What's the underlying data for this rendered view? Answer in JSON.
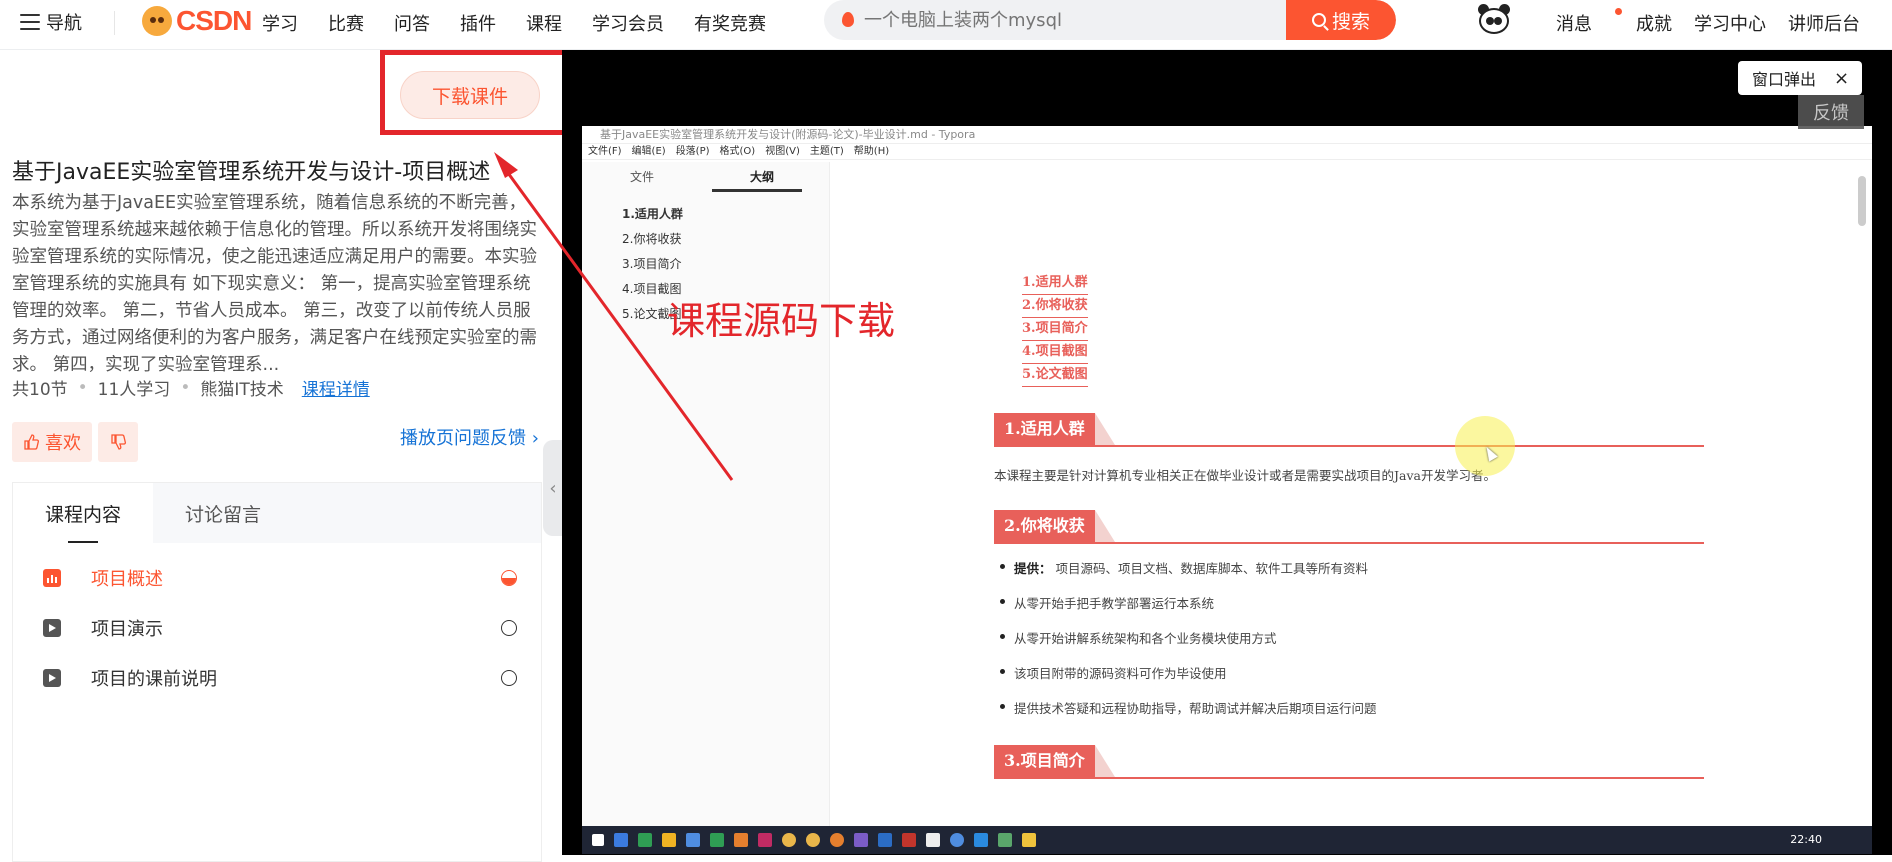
{
  "navbar": {
    "menu_label": "导航",
    "logo_text": "CSDN",
    "links": [
      "学习",
      "比赛",
      "问答",
      "插件",
      "课程",
      "学习会员",
      "有奖竞赛"
    ],
    "search_placeholder": "一个电脑上装两个mysql",
    "search_button": "搜索",
    "user_links": [
      "消息",
      "成就",
      "学习中心",
      "讲师后台"
    ]
  },
  "course": {
    "download_button": "下载课件",
    "title": "基于JavaEE实验室管理系统开发与设计-项目概述",
    "description": "本系统为基于JavaEE实验室管理系统，随着信息系统的不断完善，实验室管理系统越来越依赖于信息化的管理。所以系统开发将围绕实验室管理系统的实际情况，使之能迅速适应满足用户的需要。本实验室管理系统的实施具有 如下现实意义： 第一，提高实验室管理系统管理的效率。 第二，节省人员成本。 第三，改变了以前传统人员服务方式，通过网络便利的为客户服务，满足客户在线预定实验室的需求。 第四，实现了实验室管理系...",
    "lessons_count": "共10节",
    "learners": "11人学习",
    "author": "熊猫IT技术",
    "detail_link": "课程详情",
    "like_label": "喜欢",
    "feedback_link": "播放页问题反馈 ›"
  },
  "tabs": [
    {
      "label": "课程内容",
      "active": true
    },
    {
      "label": "讨论留言",
      "active": false
    }
  ],
  "lessons": [
    {
      "title": "项目概述",
      "active": true
    },
    {
      "title": "项目演示",
      "active": false
    },
    {
      "title": "项目的课前说明",
      "active": false
    }
  ],
  "player": {
    "popout_label": "窗口弹出",
    "popout_close": "×",
    "feedback_label": "反馈",
    "annotation": "课程源码下载"
  },
  "typora": {
    "window_title": "基于JavaEE实验室管理系统开发与设计(附源码-论文)-毕业设计.md - Typora",
    "menu": [
      "文件(F)",
      "编辑(E)",
      "段落(P)",
      "格式(O)",
      "视图(V)",
      "主题(T)",
      "帮助(H)"
    ],
    "side_tabs": [
      "文件",
      "大纲"
    ],
    "outline": [
      "1.适用人群",
      "2.你将收获",
      "3.项目简介",
      "4.项目截图",
      "5.论文截图"
    ],
    "toc": [
      "1.适用人群",
      "2.你将收获",
      "3.项目简介",
      "4.项目截图",
      "5.论文截图"
    ],
    "h_audience": "1.适用人群",
    "audience_text": "本课程主要是针对计算机专业相关正在做毕业设计或者是需要实战项目的Java开发学习者。",
    "h_gain": "2.你将收获",
    "gain_items_lead": "提供：",
    "gain_items_first": "项目源码、项目文档、数据库脚本、软件工具等所有资料",
    "gain_items": [
      "从零开始手把手教学部署运行本系统",
      "从零开始讲解系统架构和各个业务模块使用方式",
      "该项目附带的源码资料可作为毕设使用",
      "提供技术答疑和远程协助指导，帮助调试并解决后期项目运行问题"
    ],
    "h_intro": "3.项目简介",
    "clock": "22:40"
  },
  "colors": {
    "brand": "#fc5531",
    "link": "#1673d6",
    "annotation": "#e3262b",
    "heading": "#e8605a"
  }
}
